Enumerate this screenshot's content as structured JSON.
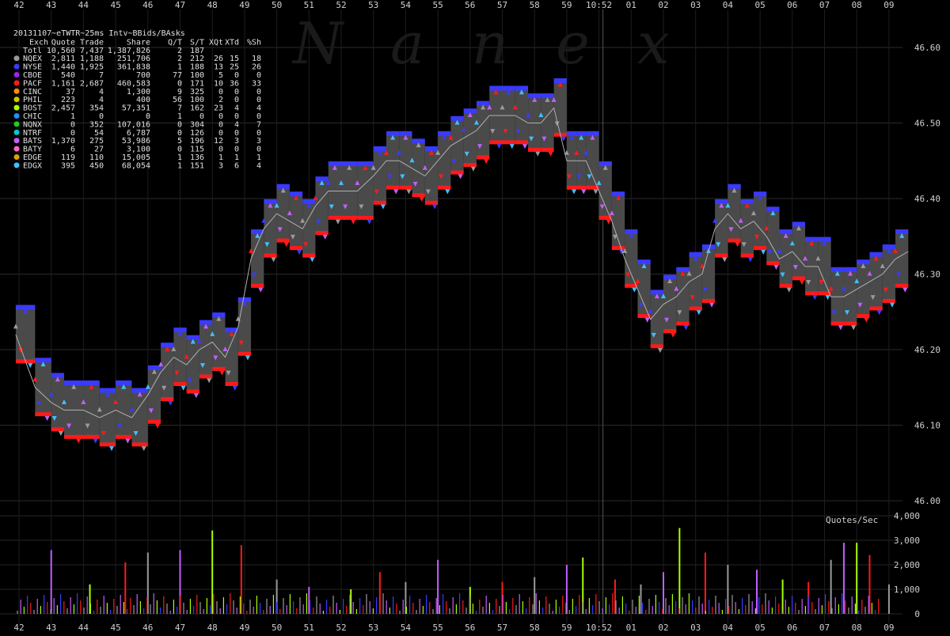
{
  "watermark": "Nanex",
  "stats_table": {
    "title": "20131107~eTWTR~25ms Intv~BBids/BAsks",
    "headers": [
      "Exch",
      "Quote",
      "Trade",
      "Share",
      "Q/T",
      "S/T",
      "XQt",
      "XTd",
      "%Sh"
    ],
    "rows": [
      {
        "exch": "Totl",
        "cells": [
          "10,560",
          "7,437",
          "1,387,826",
          "2",
          "187",
          "",
          "",
          ""
        ],
        "color": ""
      },
      {
        "exch": "NQEX",
        "cells": [
          "2,811",
          "1,188",
          "251,706",
          "2",
          "212",
          "26",
          "15",
          "18"
        ],
        "color": "#9a9a9a"
      },
      {
        "exch": "NYSE",
        "cells": [
          "1,440",
          "1,925",
          "361,838",
          "1",
          "188",
          "13",
          "25",
          "26"
        ],
        "color": "#3a3aff"
      },
      {
        "exch": "CBOE",
        "cells": [
          "540",
          "7",
          "700",
          "77",
          "100",
          "5",
          "0",
          "0"
        ],
        "color": "#a020f0"
      },
      {
        "exch": "PACF",
        "cells": [
          "1,161",
          "2,687",
          "460,583",
          "0",
          "171",
          "10",
          "36",
          "33"
        ],
        "color": "#ff1a1a"
      },
      {
        "exch": "CINC",
        "cells": [
          "37",
          "4",
          "1,300",
          "9",
          "325",
          "0",
          "0",
          "0"
        ],
        "color": "#ff8c00"
      },
      {
        "exch": "PHIL",
        "cells": [
          "223",
          "4",
          "400",
          "56",
          "100",
          "2",
          "0",
          "0"
        ],
        "color": "#d4c400"
      },
      {
        "exch": "BOST",
        "cells": [
          "2,457",
          "354",
          "57,351",
          "7",
          "162",
          "23",
          "4",
          "4"
        ],
        "color": "#aaff00"
      },
      {
        "exch": "CHIC",
        "cells": [
          "1",
          "0",
          "0",
          "1",
          "0",
          "0",
          "0",
          "0"
        ],
        "color": "#1e90ff"
      },
      {
        "exch": "NQNX",
        "cells": [
          "0",
          "352",
          "107,016",
          "0",
          "304",
          "0",
          "4",
          "7"
        ],
        "color": "#22cc22"
      },
      {
        "exch": "NTRF",
        "cells": [
          "0",
          "54",
          "6,787",
          "0",
          "126",
          "0",
          "0",
          "0"
        ],
        "color": "#00cccc"
      },
      {
        "exch": "BATS",
        "cells": [
          "1,370",
          "275",
          "53,986",
          "5",
          "196",
          "12",
          "3",
          "3"
        ],
        "color": "#c060ff"
      },
      {
        "exch": "BATY",
        "cells": [
          "6",
          "27",
          "3,100",
          "0",
          "115",
          "0",
          "0",
          "0"
        ],
        "color": "#ff66cc"
      },
      {
        "exch": "EDGE",
        "cells": [
          "119",
          "110",
          "15,005",
          "1",
          "136",
          "1",
          "1",
          "1"
        ],
        "color": "#e0a000"
      },
      {
        "exch": "EDGX",
        "cells": [
          "395",
          "450",
          "68,054",
          "1",
          "151",
          "3",
          "6",
          "4"
        ],
        "color": "#40c0ff"
      }
    ]
  },
  "chart_data": [
    {
      "type": "line",
      "title": "",
      "xlabel": "",
      "ylabel": "",
      "x_ticks": [
        "42",
        "43",
        "44",
        "45",
        "46",
        "47",
        "48",
        "49",
        "50",
        "51",
        "52",
        "53",
        "54",
        "55",
        "56",
        "57",
        "58",
        "59",
        "10:52",
        "01",
        "02",
        "03",
        "04",
        "05",
        "06",
        "07",
        "08",
        "09"
      ],
      "y_ticks": [
        "46.00",
        "46.10",
        "46.20",
        "46.30",
        "46.40",
        "46.50",
        "46.60"
      ],
      "ylim": [
        46.0,
        46.65
      ],
      "grid": true,
      "highlight_x": "10:52",
      "series": [
        {
          "name": "",
          "color": "#3a3aff",
          "x": [
            41.9,
            42.5,
            43.0,
            43.4,
            44.0,
            44.5,
            45.0,
            45.5,
            46.0,
            46.4,
            46.8,
            47.2,
            47.6,
            48.0,
            48.4,
            48.8,
            49.2,
            49.6,
            50.0,
            50.4,
            50.8,
            51.2,
            51.6,
            52.0,
            52.5,
            53.0,
            53.4,
            53.8,
            54.2,
            54.6,
            55.0,
            55.4,
            55.8,
            56.2,
            56.6,
            57.0,
            57.4,
            57.8,
            58.2,
            58.6,
            59.0,
            59.3,
            59.6,
            60.0,
            60.4,
            60.8,
            61.2,
            61.6,
            62.0,
            62.4,
            62.8,
            63.2,
            63.6,
            64.0,
            64.4,
            64.8,
            65.2,
            65.6,
            66.0,
            66.4,
            66.8,
            67.2,
            67.6,
            68.0,
            68.4,
            68.8,
            69.2,
            69.6
          ],
          "values": [
            46.22,
            46.15,
            46.13,
            46.12,
            46.12,
            46.11,
            46.12,
            46.11,
            46.14,
            46.17,
            46.19,
            46.18,
            46.2,
            46.21,
            46.19,
            46.23,
            46.32,
            46.36,
            46.38,
            46.37,
            46.36,
            46.39,
            46.41,
            46.41,
            46.41,
            46.43,
            46.45,
            46.45,
            46.44,
            46.43,
            46.45,
            46.47,
            46.48,
            46.49,
            46.51,
            46.51,
            46.51,
            46.5,
            46.5,
            46.52,
            46.45,
            46.45,
            46.45,
            46.41,
            46.37,
            46.32,
            46.28,
            46.24,
            46.26,
            46.27,
            46.29,
            46.3,
            46.36,
            46.38,
            46.36,
            46.37,
            46.35,
            46.32,
            46.33,
            46.31,
            46.31,
            46.27,
            46.27,
            46.28,
            46.29,
            46.3,
            46.32,
            46.33
          ]
        }
      ]
    },
    {
      "type": "bar",
      "title": "Quotes/Sec",
      "xlabel": "",
      "ylabel": "",
      "y_ticks": [
        "0",
        "1,000",
        "2,000",
        "3,000",
        "4,000"
      ],
      "ylim": [
        0,
        4000
      ],
      "series": [
        {
          "name": "",
          "x": [
            43.0,
            44.2,
            45.3,
            46.0,
            47.0,
            48.0,
            48.9,
            50.0,
            51.0,
            52.3,
            53.2,
            54.0,
            55.0,
            56.0,
            57.0,
            58.0,
            59.0,
            59.5,
            60.5,
            61.3,
            62.0,
            62.5,
            63.3,
            64.0,
            64.9,
            65.7,
            66.5,
            67.2,
            67.6,
            68.0,
            68.4,
            69.0
          ],
          "values": [
            2600,
            1200,
            2100,
            2500,
            2600,
            3400,
            2800,
            1400,
            1100,
            1000,
            1700,
            1300,
            2200,
            1100,
            1300,
            1500,
            2000,
            2300,
            1400,
            1200,
            1700,
            3500,
            2500,
            2000,
            1800,
            1400,
            1300,
            2200,
            2900,
            2900,
            2400,
            1200
          ]
        }
      ]
    }
  ]
}
